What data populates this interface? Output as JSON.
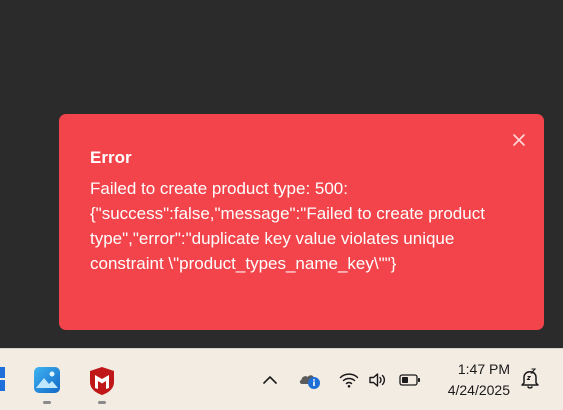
{
  "toast": {
    "title": "Error",
    "message": "Failed to create product type: 500: {\"success\":false,\"message\":\"Failed to create product type\",\"error\":\"duplicate key value violates unique constraint \\\"product_types_name_key\\\"\"}",
    "background": "#f2444a",
    "close_icon": "close-icon"
  },
  "taskbar": {
    "pinned": [
      {
        "name": "start-icon"
      },
      {
        "name": "photos-app-icon"
      },
      {
        "name": "mcafee-icon"
      }
    ],
    "tray": {
      "time": "1:47 PM",
      "date": "4/24/2025",
      "icons": [
        "chevron-up-icon",
        "onedrive-icon",
        "wifi-icon",
        "volume-icon",
        "battery-icon",
        "notifications-icon"
      ]
    }
  }
}
